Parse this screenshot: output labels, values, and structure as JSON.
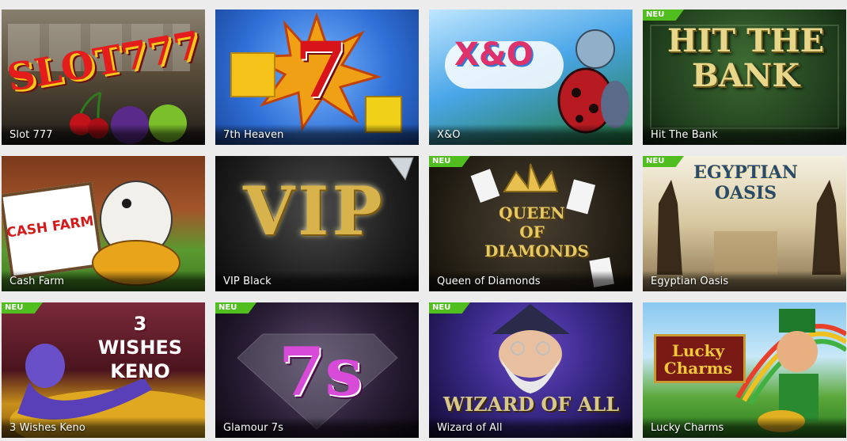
{
  "badge_label": "NEU",
  "games": [
    {
      "name": "Slot 777",
      "new": false,
      "logo": "SLOT777",
      "colors": [
        "#6b5a2a",
        "#2b2b2b"
      ],
      "icon": "cherry-fruit-icon"
    },
    {
      "name": "7th Heaven",
      "new": false,
      "logo": "7",
      "colors": [
        "#2f6fd6",
        "#f08a12"
      ],
      "icon": "heaven-seven-icon"
    },
    {
      "name": "X&O",
      "new": false,
      "logo": "X&O",
      "colors": [
        "#1d8ad6",
        "#2f9a3a"
      ],
      "icon": "ladybug-icon"
    },
    {
      "name": "Hit The Bank",
      "new": true,
      "logo": "HIT THE BANK",
      "colors": [
        "#254a22",
        "#0f2a12"
      ],
      "icon": "bank-icon"
    },
    {
      "name": "Cash Farm",
      "new": false,
      "logo": "CASH FARM",
      "colors": [
        "#4e8a2e",
        "#7a3a1a"
      ],
      "icon": "goose-icon"
    },
    {
      "name": "VIP Black",
      "new": false,
      "logo": "VIP",
      "colors": [
        "#2a2a2a",
        "#111111"
      ],
      "icon": "diamond-icon"
    },
    {
      "name": "Queen of Diamonds",
      "new": true,
      "logo": "QUEEN OF DIAMONDS",
      "colors": [
        "#3a3326",
        "#1a1612"
      ],
      "icon": "crown-icon"
    },
    {
      "name": "Egyptian Oasis",
      "new": true,
      "logo": "EGYPTIAN OASIS",
      "colors": [
        "#c9b38a",
        "#6a5a3a"
      ],
      "icon": "anubis-icon"
    },
    {
      "name": "3 Wishes Keno",
      "new": true,
      "logo": "3 WISHES KENO",
      "colors": [
        "#6a1f2e",
        "#3a1016"
      ],
      "icon": "genie-icon"
    },
    {
      "name": "Glamour 7s",
      "new": true,
      "logo": "7s",
      "colors": [
        "#3a2a4a",
        "#120c1a"
      ],
      "icon": "glamour-seven-icon"
    },
    {
      "name": "Wizard of All",
      "new": true,
      "logo": "WIZARD OF ALL",
      "colors": [
        "#3a2a7a",
        "#120a30"
      ],
      "icon": "wizard-icon"
    },
    {
      "name": "Lucky Charms",
      "new": false,
      "logo": "Lucky Charms",
      "colors": [
        "#6ab0e0",
        "#3a8a2a"
      ],
      "icon": "leprechaun-icon"
    }
  ]
}
